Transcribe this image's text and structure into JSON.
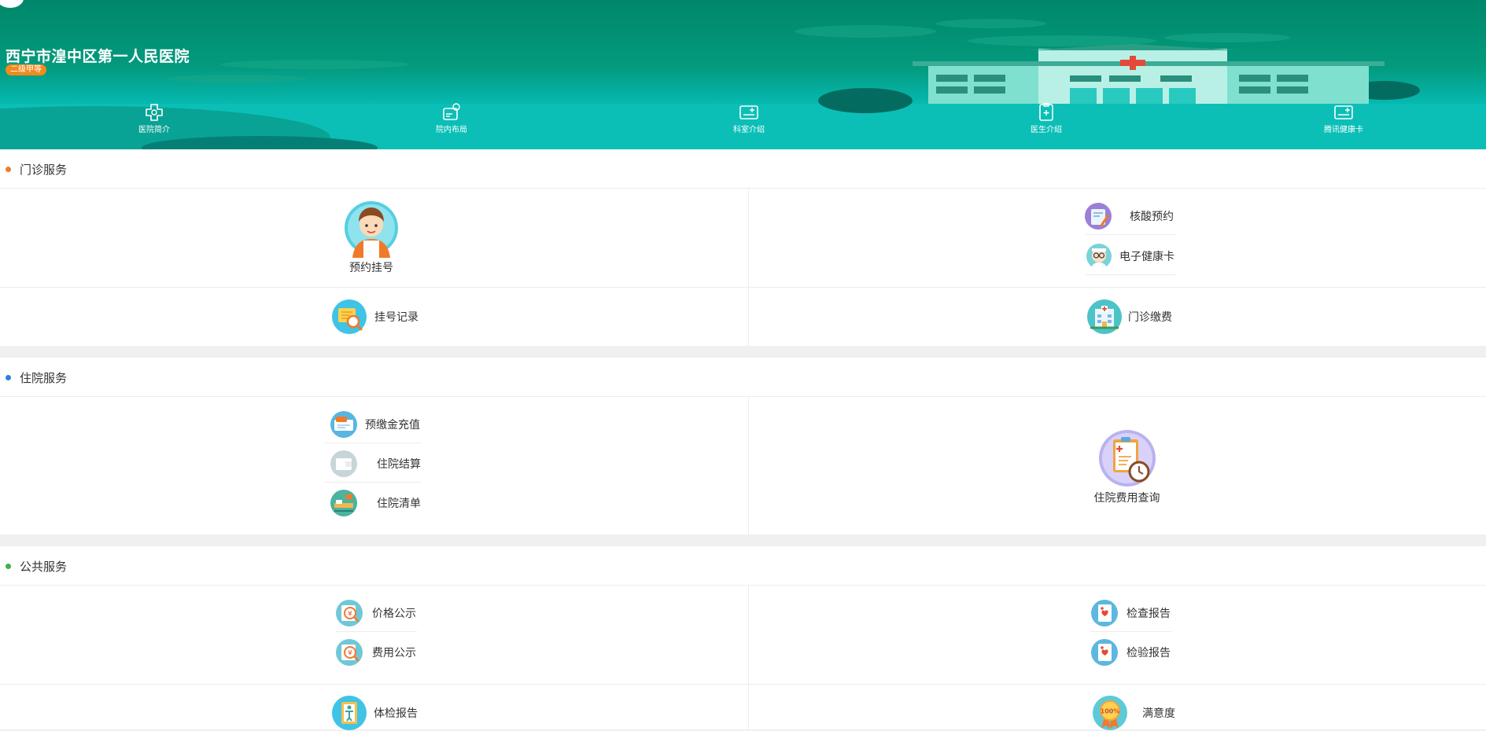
{
  "header": {
    "hospital_name": "西宁市湟中区第一人民医院",
    "badge": "二级甲等",
    "nav": [
      {
        "label": "医院简介",
        "icon": "hospital-cross-icon"
      },
      {
        "label": "院内布局",
        "icon": "floor-map-icon"
      },
      {
        "label": "科室介绍",
        "icon": "department-card-icon"
      },
      {
        "label": "医生介绍",
        "icon": "doctor-clipboard-icon"
      },
      {
        "label": "腾讯健康卡",
        "icon": "health-card-icon"
      }
    ]
  },
  "outpatient": {
    "title": "门诊服务",
    "dot_color": "#f07a2a",
    "appointment": "预约挂号",
    "nucleic_booking": "核酸预约",
    "e_health_card": "电子健康卡",
    "registration_records": "挂号记录",
    "outpatient_payment": "门诊缴费"
  },
  "inpatient": {
    "title": "住院服务",
    "dot_color": "#2f7fe0",
    "deposit_recharge": "预缴金充值",
    "settlement": "住院结算",
    "inpatient_list": "住院清单",
    "expense_query": "住院费用查询"
  },
  "public": {
    "title": "公共服务",
    "dot_color": "#3cb34a",
    "price_notice": "价格公示",
    "fee_notice": "费用公示",
    "exam_report": "检查报告",
    "lab_report": "检验报告",
    "physical_report": "体检报告",
    "satisfaction": "满意度"
  }
}
